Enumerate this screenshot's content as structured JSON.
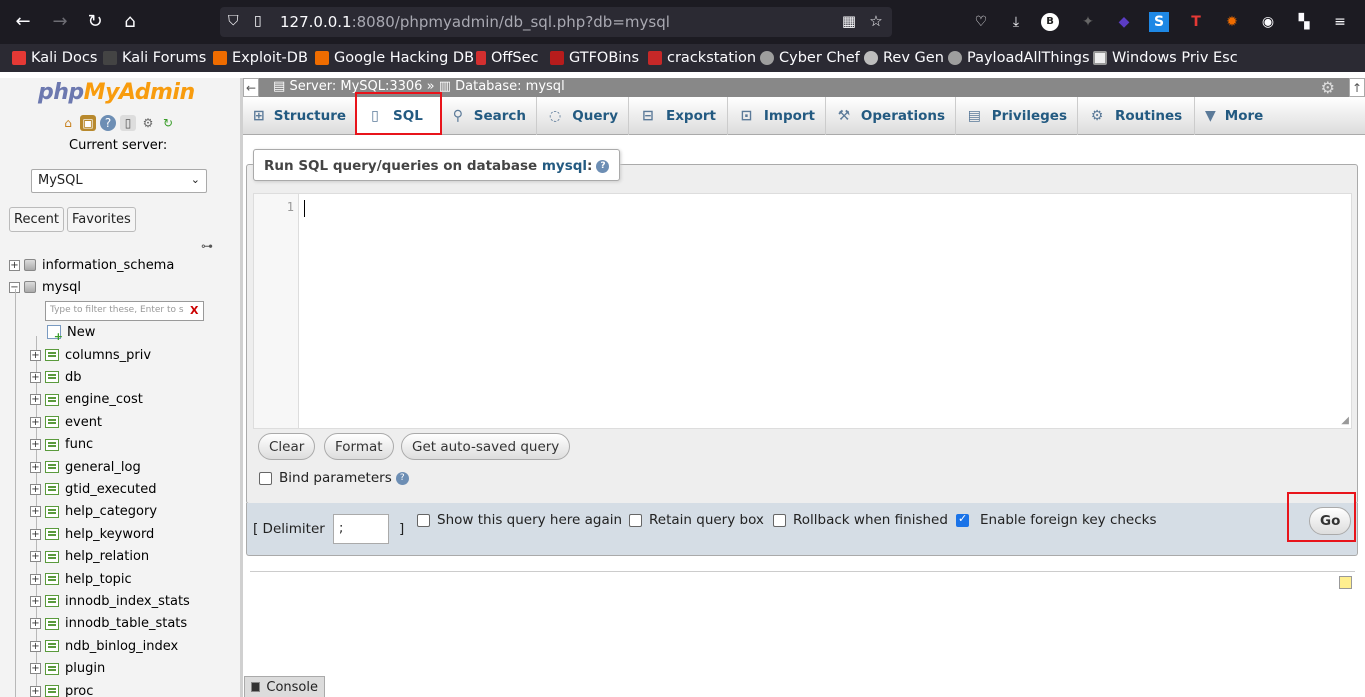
{
  "browser": {
    "url_host": "127.0.0.1",
    "url_rest": ":8080/phpmyadmin/db_sql.php?db=mysql"
  },
  "bookmarks": [
    {
      "label": "Kali Docs",
      "color": "#e53935"
    },
    {
      "label": "Kali Forums",
      "color": "#444444"
    },
    {
      "label": "Exploit-DB",
      "color": "#ef6c00"
    },
    {
      "label": "Google Hacking DB",
      "color": "#ef6c00"
    },
    {
      "label": "OffSec",
      "color": "#d32f2f"
    },
    {
      "label": "GTFOBins",
      "color": "#b71c1c"
    },
    {
      "label": "crackstation",
      "color": "#c62828"
    },
    {
      "label": "Cyber Chef",
      "color": "#9e9e9e"
    },
    {
      "label": "Rev Gen",
      "color": "#bdbdbd"
    },
    {
      "label": "PayloadAllThings",
      "color": "#9e9e9e"
    },
    {
      "label": "Windows Priv Esc",
      "color": "#eeeeee"
    }
  ],
  "sidebar": {
    "logo_php": "php",
    "logo_myadmin": "MyAdmin",
    "current_server_label": "Current server:",
    "server_select": "MySQL",
    "recent_label": "Recent",
    "favorites_label": "Favorites",
    "databases": [
      "information_schema",
      "mysql"
    ],
    "filter_placeholder": "Type to filter these, Enter to s",
    "filter_clear": "X",
    "new_label": "New",
    "tables": [
      "columns_priv",
      "db",
      "engine_cost",
      "event",
      "func",
      "general_log",
      "gtid_executed",
      "help_category",
      "help_keyword",
      "help_relation",
      "help_topic",
      "innodb_index_stats",
      "innodb_table_stats",
      "ndb_binlog_index",
      "plugin",
      "proc"
    ]
  },
  "breadcrumb": {
    "server": "Server: MySQL:3306",
    "separator": "»",
    "database": "Database: mysql"
  },
  "tabs": [
    {
      "label": "Structure",
      "icon": "structure-icon"
    },
    {
      "label": "SQL",
      "icon": "sql-icon"
    },
    {
      "label": "Search",
      "icon": "search-icon"
    },
    {
      "label": "Query",
      "icon": "query-icon"
    },
    {
      "label": "Export",
      "icon": "export-icon"
    },
    {
      "label": "Import",
      "icon": "import-icon"
    },
    {
      "label": "Operations",
      "icon": "wrench-icon"
    },
    {
      "label": "Privileges",
      "icon": "privileges-icon"
    },
    {
      "label": "Routines",
      "icon": "routines-icon"
    },
    {
      "label": "More",
      "icon": "chevron-down-icon"
    }
  ],
  "sql_panel": {
    "legend_prefix": "Run SQL query/queries on database ",
    "legend_db": "mysql",
    "legend_suffix": ":",
    "line_number": "1",
    "query_text": "",
    "clear_label": "Clear",
    "format_label": "Format",
    "autosaved_label": "Get auto-saved query",
    "bind_parameters_label": "Bind parameters"
  },
  "options": {
    "delimiter_open": "[ Delimiter",
    "delimiter_value": ";",
    "delimiter_close": "]",
    "show_query_label": "Show this query here again",
    "retain_box_label": "Retain query box",
    "rollback_label": "Rollback when finished",
    "foreign_keys_label": "Enable foreign key checks",
    "go_label": "Go"
  },
  "console": {
    "label": "Console"
  },
  "colors": {
    "highlight": "#e8141b",
    "link": "#235a81",
    "logo_php": "#6c78af",
    "logo_myadmin": "#f89c0e"
  }
}
